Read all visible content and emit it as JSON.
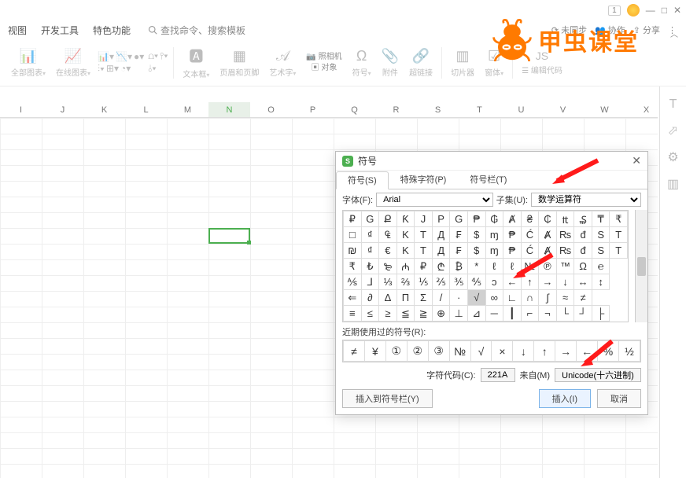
{
  "titlebar": {
    "pill": "1",
    "min": "—",
    "max": "□",
    "close": "✕"
  },
  "menu": {
    "m1": "视图",
    "m2": "开发工具",
    "m3": "特色功能",
    "search_ph": "查找命令、搜索模板"
  },
  "status": {
    "sync": "未同步",
    "collab": "协作",
    "share": "分享"
  },
  "ribbon": {
    "g1": "全部图表",
    "g2": "在线图表",
    "g3": "文本框",
    "g4": "页眉和页脚",
    "g5": "艺术字",
    "g6a": "照相机",
    "g6b": "对象",
    "g7": "符号",
    "g8": "附件",
    "g9": "超链接",
    "g10": "切片器",
    "g11": "窗体",
    "g12": "编辑代码",
    "drop": "▾"
  },
  "logo": {
    "text": "甲虫课堂"
  },
  "columns": [
    "I",
    "J",
    "K",
    "L",
    "M",
    "N",
    "O",
    "P",
    "Q",
    "R",
    "S",
    "T",
    "U",
    "V",
    "W",
    "X"
  ],
  "dialog": {
    "title": "符号",
    "tabs": {
      "t1": "符号(S)",
      "t2": "特殊字符(P)",
      "t3": "符号栏(T)"
    },
    "font_lbl": "字体(F):",
    "font_val": "Arial",
    "subset_lbl": "子集(U):",
    "subset_val": "数学运算符",
    "grid": [
      [
        "₽",
        "G",
        "Ք",
        "Ƙ",
        "J",
        "P",
        "G",
        "₱",
        "₲",
        "Ⱥ",
        "₴",
        "₵",
        "₶",
        "₷",
        "₸",
        "₹"
      ],
      [
        "□",
        "₫",
        "₠",
        "K",
        "T",
        "Д",
        "₣",
        "$",
        "ɱ",
        "₱",
        "Ć",
        "Ⱥ",
        "₨",
        "đ",
        "S",
        "T"
      ],
      [
        "₪",
        "₫",
        "€",
        "K",
        "T",
        "Д",
        "₣",
        "$",
        "ɱ",
        "₱",
        "Ć",
        "Ⱥ",
        "₨",
        "đ",
        "S",
        "T"
      ],
      [
        "₹",
        "₺",
        "₻",
        "₼",
        "₽",
        "₾",
        "₿",
        "*",
        "ℓ",
        "ℓ",
        "№",
        "℗",
        "™",
        "Ω",
        "℮"
      ],
      [
        "⅍",
        "⅃",
        "⅓",
        "⅔",
        "⅕",
        "⅖",
        "⅗",
        "⅘",
        "ↄ",
        "←",
        "↑",
        "→",
        "↓",
        "↔",
        "↕"
      ],
      [
        "⇐",
        "∂",
        "Δ",
        "Π",
        "Σ",
        "/",
        "·",
        "√",
        "∞",
        "∟",
        "∩",
        "∫",
        "≈",
        "≠"
      ],
      [
        "≡",
        "≤",
        "≥",
        "≦",
        "≧",
        "⊕",
        "⊥",
        "⊿",
        "─",
        "┃",
        "⌐",
        "¬",
        "└",
        "┘",
        "├"
      ]
    ],
    "hl_row": 5,
    "hl_col": 7,
    "recent_lbl": "近期使用过的符号(R):",
    "recent": [
      "≠",
      "¥",
      "①",
      "②",
      "③",
      "№",
      "√",
      "×",
      "↓",
      "↑",
      "→",
      "←",
      "%",
      "½"
    ],
    "code_lbl": "字符代码(C):",
    "code_val": "221A",
    "from_lbl": "来自(M)",
    "from_val": "Unicode(十六进制)",
    "btn_bar": "插入到符号栏(Y)",
    "btn_insert": "插入(I)",
    "btn_cancel": "取消"
  }
}
